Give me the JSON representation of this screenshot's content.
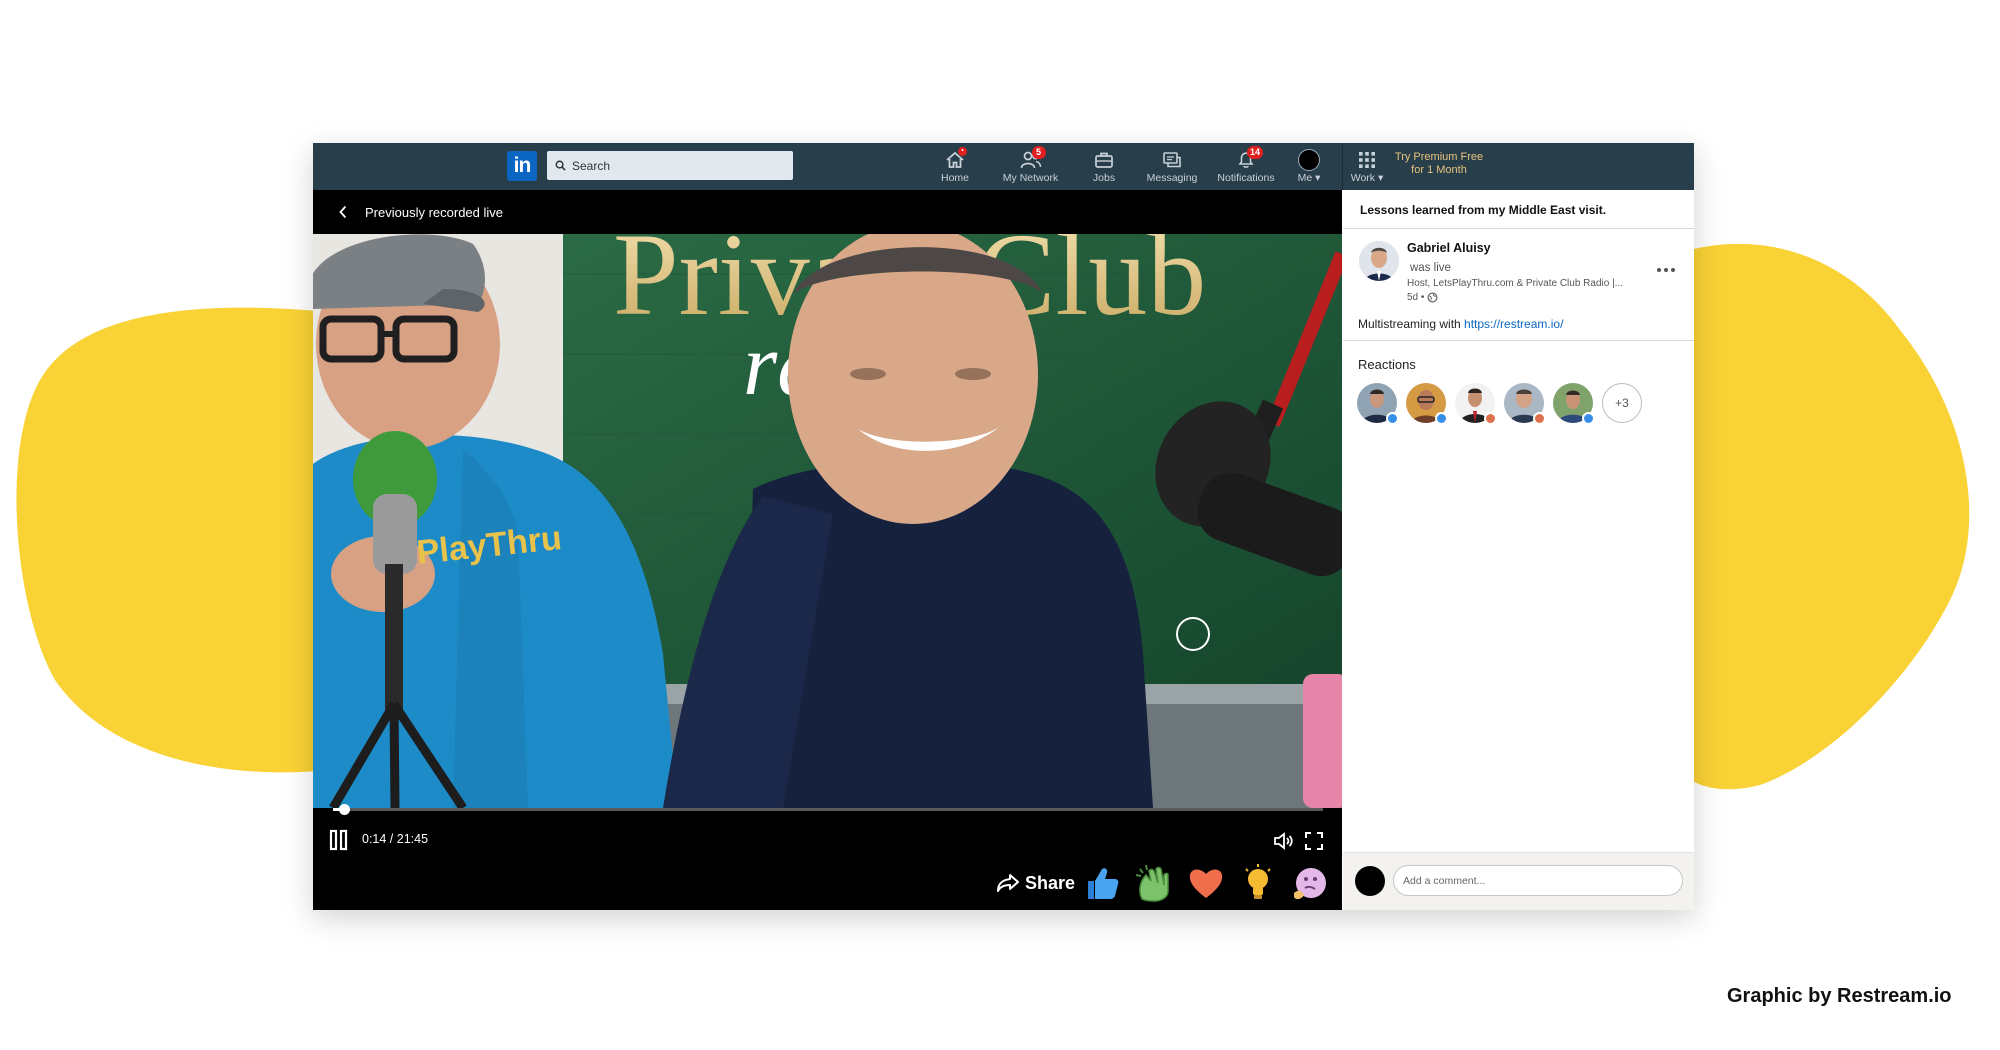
{
  "colors": {
    "backdrop_blob": "#f9d235",
    "nav_bg": "#283e4a",
    "linkedin_blue": "#0a66c2",
    "premium_gold": "#e8c37d",
    "badge_red": "#e02020"
  },
  "nav": {
    "logo_text": "in",
    "search_placeholder": "Search",
    "items": [
      {
        "label": "Home",
        "icon": "home-icon",
        "badge": "•"
      },
      {
        "label": "My Network",
        "icon": "network-icon",
        "badge": "5"
      },
      {
        "label": "Jobs",
        "icon": "briefcase-icon",
        "badge": ""
      },
      {
        "label": "Messaging",
        "icon": "messaging-icon",
        "badge": ""
      },
      {
        "label": "Notifications",
        "icon": "bell-icon",
        "badge": "14"
      },
      {
        "label": "Me",
        "icon": "avatar",
        "badge": ""
      }
    ],
    "work_label": "Work",
    "premium_line1": "Try Premium Free",
    "premium_line2": "for 1 Month"
  },
  "video": {
    "back_label": "Previously recorded live",
    "current_time": "0:14",
    "duration": "21:45",
    "time_display": "0:14 / 21:45",
    "progress_fraction": 0.011,
    "backdrop_text_line1": "Private Club",
    "backdrop_text_line2": "radio sh",
    "share_label": "Share",
    "reactions": [
      "like-icon",
      "celebrate-icon",
      "love-icon",
      "insightful-icon",
      "curious-icon"
    ]
  },
  "side": {
    "title": "Lessons learned from my Middle East visit.",
    "author_name": "Gabriel Aluisy",
    "status": "was live",
    "headline": "Host, LetsPlayThru.com & Private Club Radio |...",
    "time": "5d •",
    "body_text": "Multistreaming with ",
    "body_link": "https://restream.io/",
    "reactions_title": "Reactions",
    "reactors": [
      {
        "reaction": "like",
        "color": "#378fe9"
      },
      {
        "reaction": "like",
        "color": "#378fe9"
      },
      {
        "reaction": "love",
        "color": "#df704d"
      },
      {
        "reaction": "love",
        "color": "#df704d"
      },
      {
        "reaction": "like",
        "color": "#378fe9"
      }
    ],
    "more_reactors": "+3",
    "comment_placeholder": "Add a comment..."
  },
  "credit": "Graphic by Restream.io"
}
